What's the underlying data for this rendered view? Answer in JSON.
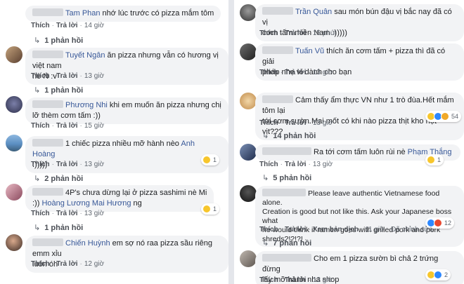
{
  "reply_arrow": "↳",
  "left": [
    {
      "name": "Tam Phan",
      "text": "nhớ lúc trước có pizza mắm tôm",
      "actions": {
        "like": "Thích",
        "reply": "Trả lời",
        "time": "14 giờ"
      },
      "replies": "1 phản hồi"
    },
    {
      "name": "Tuyết Ngân",
      "text1": "ăn pizza nhưng vẫn có hương vị việt nam",
      "text2": "nè N :v",
      "actions": {
        "like": "Thích",
        "reply": "Trả lời",
        "time": "13 giờ"
      },
      "replies": "1 phản hồi"
    },
    {
      "name": "Phương Nhi",
      "text1": "khi em muốn ăn pizza nhưng chị",
      "text2": "lỡ thèm cơm tấm :))",
      "actions": {
        "like": "Thích",
        "reply": "Trả lời",
        "time": "15 giờ"
      }
    },
    {
      "text1_pre": "1 chiếc pizza nhiều mỡ hành nèo",
      "mention": "Anh Hoàng",
      "text2": ":)))))",
      "actions": {
        "like": "Thích",
        "reply": "Trả lời",
        "time": "13 giờ"
      },
      "reaction_count": "1",
      "replies": "2 phản hồi"
    },
    {
      "text1": "4P's chưa dừng lại ở pizza sashimi nè Mi",
      "text2_pre": ":))",
      "mention": "Hoàng Lương Mai Hương",
      "text2_post": "ng",
      "actions": {
        "like": "Thích",
        "reply": "Trả lời",
        "time": "13 giờ"
      },
      "reaction_count": "1",
      "replies": "1 phản hồi"
    },
    {
      "name": "Chiến Huỳnh",
      "text1": "em sợ nó raa pizza sầu riêng emm xỉu",
      "text2": "luôn óh",
      "actions": {
        "like": "Thích",
        "reply": "Trả lời",
        "time": "12 giờ"
      }
    }
  ],
  "right": [
    {
      "name": "Trần Quân",
      "text1": "sau món bún đậu vị bắc nay đã có vị",
      "text2": "cơm tấm miền Nam :)))))",
      "actions": {
        "like": "Thích",
        "reply": "Trả lời",
        "time": "15 phút"
      }
    },
    {
      "name": "Tuấn Vũ",
      "text1": "thích ăn cơm tấm + pizza thì đã có giải",
      "text2": "pháp nhẹ ví dành cho bạn",
      "actions": {
        "like": "Thích",
        "reply": "Trả lời",
        "time": "13 giờ"
      }
    },
    {
      "text1": "Cảm thấy ẩm thực VN như 1 trò đùa.Hết mắm tôm lại",
      "text2": "tới cơm sườn.Mai mốt có khi nào pizza thịt kho hột vịt???",
      "actions": {
        "like": "Thích",
        "reply": "Trả lời",
        "time": "13 giờ"
      },
      "reaction_count": "54",
      "replies": "14 phản hồi"
    },
    {
      "text_pre": "Ra tới cơm tấm luôn rùi nè",
      "mention": "Phạm Thắng",
      "actions": {
        "like": "Thích",
        "reply": "Trả lời",
        "time": "13 giờ"
      },
      "reaction_count": "1",
      "replies": "5 phản hồi"
    },
    {
      "text1": "Please leave authentic Vietnamese food alone.",
      "text2": "Creation is good but not like this. Ask your Japanese boss what",
      "text3": "he would think if ramen goes with grilled pork and pork",
      "text4": "shreds?!?!?!",
      "actions": {
        "like": "Thích",
        "reply": "Trả lời",
        "translate": "Xem bản dịch",
        "time": "11 giờ",
        "edited": "Đã chỉnh sửa"
      },
      "reaction_count": "12",
      "replies": "7 phản hồi"
    },
    {
      "text1": "Cho em 1 pizza sườn bì chả 2 trứng đừng",
      "text2": "lấy mỡ hành nha shop",
      "actions": {
        "like": "Thích",
        "reply": "Trả lời",
        "time": "13 giờ"
      },
      "reaction_count": "2"
    }
  ]
}
